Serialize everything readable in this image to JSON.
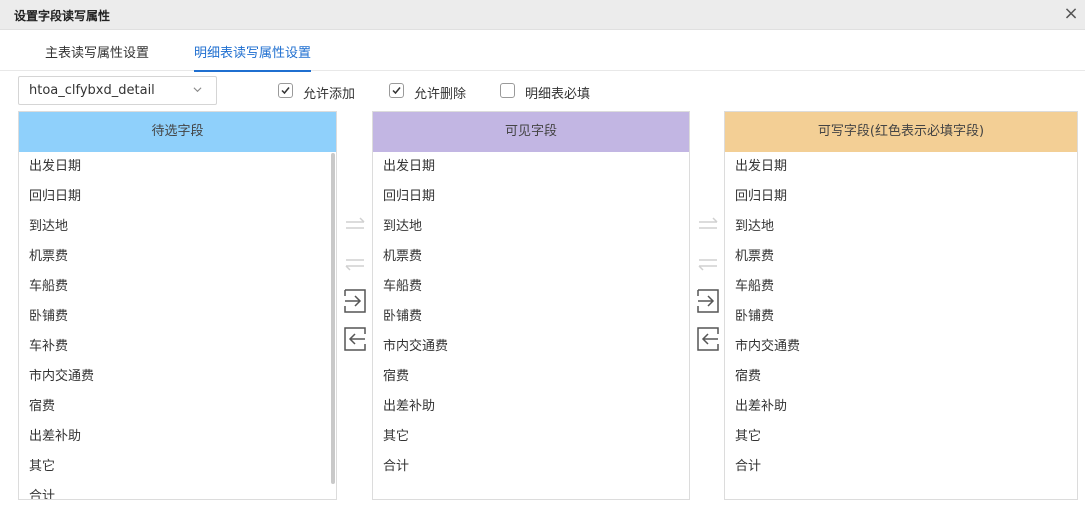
{
  "dialog": {
    "title": "设置字段读写属性",
    "close_label": "×"
  },
  "tabs": [
    {
      "label": "主表读写属性设置"
    },
    {
      "label": "明细表读写属性设置"
    }
  ],
  "table_select": {
    "value": "htoa_clfybxd_detail"
  },
  "options": {
    "allow_add": "允许添加",
    "allow_delete": "允许删除",
    "detail_required": "明细表必填"
  },
  "panels": {
    "candidate": {
      "header": "待选字段",
      "items": [
        "出发日期",
        "回归日期",
        "到达地",
        "机票费",
        "车船费",
        "卧铺费",
        "车补费",
        "市内交通费",
        "宿费",
        "出差补助",
        "其它",
        "合计"
      ]
    },
    "visible": {
      "header": "可见字段",
      "items": [
        "出发日期",
        "回归日期",
        "到达地",
        "机票费",
        "车船费",
        "卧铺费",
        "市内交通费",
        "宿费",
        "出差补助",
        "其它",
        "合计"
      ]
    },
    "writable": {
      "header": "可写字段(红色表示必填字段)",
      "items": [
        "出发日期",
        "回归日期",
        "到达地",
        "机票费",
        "车船费",
        "卧铺费",
        "市内交通费",
        "宿费",
        "出差补助",
        "其它",
        "合计"
      ]
    }
  }
}
